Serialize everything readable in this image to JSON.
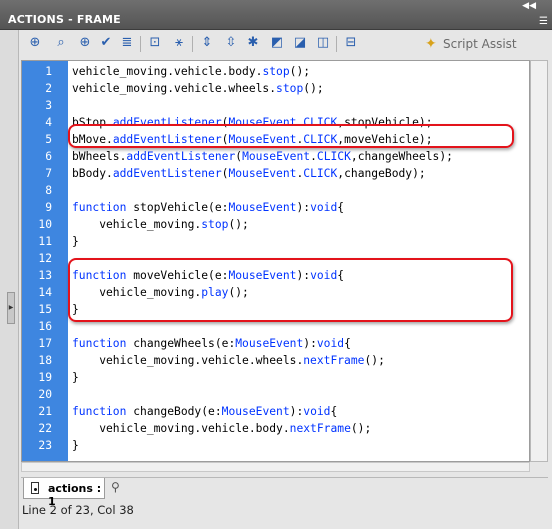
{
  "window": {
    "title": "ACTIONS - FRAME",
    "collapse_glyph": "◀◀",
    "menu_glyph": "☰"
  },
  "toolbar": {
    "icons": [
      "add-statement-icon",
      "find-icon",
      "target-path-icon",
      "check-syntax-icon",
      "auto-format-icon",
      "code-hint-icon",
      "debug-options-icon",
      "collapse-between-braces-icon",
      "collapse-selection-icon",
      "expand-all-icon",
      "apply-block-comment-icon",
      "apply-line-comment-icon",
      "remove-comment-icon",
      "show-hide-toolbox-icon"
    ],
    "script_assist_label": "Script Assist"
  },
  "code": {
    "lines": [
      [
        {
          "t": "vehicle_moving.vehicle.body.",
          "c": "p"
        },
        {
          "t": "stop",
          "c": "kw"
        },
        {
          "t": "();",
          "c": "p"
        }
      ],
      [
        {
          "t": "vehicle_moving.vehicle.wheels.",
          "c": "p"
        },
        {
          "t": "stop",
          "c": "kw"
        },
        {
          "t": "();",
          "c": "p"
        }
      ],
      [],
      [
        {
          "t": "bStop.",
          "c": "p"
        },
        {
          "t": "addEventListener",
          "c": "kw"
        },
        {
          "t": "(",
          "c": "p"
        },
        {
          "t": "MouseEvent",
          "c": "kw"
        },
        {
          "t": ".",
          "c": "p"
        },
        {
          "t": "CLICK",
          "c": "kw"
        },
        {
          "t": ",stopVehicle);",
          "c": "p"
        }
      ],
      [
        {
          "t": "bMove.",
          "c": "p"
        },
        {
          "t": "addEventListener",
          "c": "kw"
        },
        {
          "t": "(",
          "c": "p"
        },
        {
          "t": "MouseEvent",
          "c": "kw"
        },
        {
          "t": ".",
          "c": "p"
        },
        {
          "t": "CLICK",
          "c": "kw"
        },
        {
          "t": ",moveVehicle);",
          "c": "p"
        }
      ],
      [
        {
          "t": "bWheels.",
          "c": "p"
        },
        {
          "t": "addEventListener",
          "c": "kw"
        },
        {
          "t": "(",
          "c": "p"
        },
        {
          "t": "MouseEvent",
          "c": "kw"
        },
        {
          "t": ".",
          "c": "p"
        },
        {
          "t": "CLICK",
          "c": "kw"
        },
        {
          "t": ",changeWheels);",
          "c": "p"
        }
      ],
      [
        {
          "t": "bBody.",
          "c": "p"
        },
        {
          "t": "addEventListener",
          "c": "kw"
        },
        {
          "t": "(",
          "c": "p"
        },
        {
          "t": "MouseEvent",
          "c": "kw"
        },
        {
          "t": ".",
          "c": "p"
        },
        {
          "t": "CLICK",
          "c": "kw"
        },
        {
          "t": ",changeBody);",
          "c": "p"
        }
      ],
      [],
      [
        {
          "t": "function",
          "c": "kw"
        },
        {
          "t": " stopVehicle(e:",
          "c": "p"
        },
        {
          "t": "MouseEvent",
          "c": "kw"
        },
        {
          "t": "):",
          "c": "p"
        },
        {
          "t": "void",
          "c": "kw"
        },
        {
          "t": "{",
          "c": "p"
        }
      ],
      [
        {
          "t": "    vehicle_moving.",
          "c": "p"
        },
        {
          "t": "stop",
          "c": "kw"
        },
        {
          "t": "();",
          "c": "p"
        }
      ],
      [
        {
          "t": "}",
          "c": "p"
        }
      ],
      [],
      [
        {
          "t": "function",
          "c": "kw"
        },
        {
          "t": " moveVehicle(e:",
          "c": "p"
        },
        {
          "t": "MouseEvent",
          "c": "kw"
        },
        {
          "t": "):",
          "c": "p"
        },
        {
          "t": "void",
          "c": "kw"
        },
        {
          "t": "{",
          "c": "p"
        }
      ],
      [
        {
          "t": "    vehicle_moving.",
          "c": "p"
        },
        {
          "t": "play",
          "c": "kw"
        },
        {
          "t": "();",
          "c": "p"
        }
      ],
      [
        {
          "t": "}",
          "c": "p"
        }
      ],
      [],
      [
        {
          "t": "function",
          "c": "kw"
        },
        {
          "t": " changeWheels(e:",
          "c": "p"
        },
        {
          "t": "MouseEvent",
          "c": "kw"
        },
        {
          "t": "):",
          "c": "p"
        },
        {
          "t": "void",
          "c": "kw"
        },
        {
          "t": "{",
          "c": "p"
        }
      ],
      [
        {
          "t": "    vehicle_moving.vehicle.wheels.",
          "c": "p"
        },
        {
          "t": "nextFrame",
          "c": "kw"
        },
        {
          "t": "();",
          "c": "p"
        }
      ],
      [
        {
          "t": "}",
          "c": "p"
        }
      ],
      [],
      [
        {
          "t": "function",
          "c": "kw"
        },
        {
          "t": " changeBody(e:",
          "c": "p"
        },
        {
          "t": "MouseEvent",
          "c": "kw"
        },
        {
          "t": "):",
          "c": "p"
        },
        {
          "t": "void",
          "c": "kw"
        },
        {
          "t": "{",
          "c": "p"
        }
      ],
      [
        {
          "t": "    vehicle_moving.vehicle.body.",
          "c": "p"
        },
        {
          "t": "nextFrame",
          "c": "kw"
        },
        {
          "t": "();",
          "c": "p"
        }
      ],
      [
        {
          "t": "}",
          "c": "p"
        }
      ]
    ],
    "highlighted_lines": [
      5,
      13,
      14,
      15
    ],
    "highlight_color": "#e3131b",
    "keyword_color": "#0033ff",
    "gutter_color": "#3e86e0"
  },
  "tabs": [
    {
      "label": "actions : 1"
    }
  ],
  "status": "Line 2 of 23, Col 38"
}
